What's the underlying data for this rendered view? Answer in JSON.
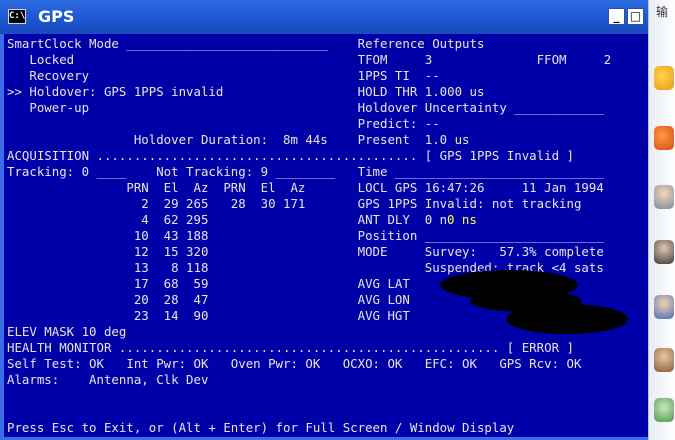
{
  "window": {
    "title": "GPS",
    "icon_label": "C:\\",
    "minimize": "_",
    "maximize": "□"
  },
  "taskbar_text": "输",
  "lines": [
    "SmartClock Mode ___________________________    Reference Outputs",
    "   Locked                                      TFOM     3              FFOM     2",
    "   Recovery                                    1PPS TI  --",
    ">> Holdover: GPS 1PPS invalid                  HOLD THR 1.000 us",
    "   Power-up                                    Holdover Uncertainty ____________",
    "                                               Predict: --",
    "                 Holdover Duration:  8m 44s    Present  1.0 us",
    "ACQUISITION ........................................... [ GPS 1PPS Invalid ]",
    "Tracking: 0 ____    Not Tracking: 9 ________   Time ____________________________",
    "                PRN  El  Az  PRN  El  Az       LOCL GPS 16:47:26     11 Jan 1994",
    "                  2  29 265   28  30 171       GPS 1PPS Invalid: not tracking",
    "                  4  62 295                    ANT DLY  0 ns",
    "                 10  43 188                    Position ________________________",
    "                 12  15 320                    MODE     Survey:   57.3% complete",
    "                 13   8 118                             Suspended: track <4 sats",
    "                 17  68  59                    AVG LAT",
    "                 20  28  47                    AVG LON",
    "                 23  14  90                    AVG HGT                         L>",
    "ELEV MASK 10 deg",
    "HEALTH MONITOR ................................................... [ ERROR ]",
    "Self Test: OK   Int Pwr: OK   Oven Pwr: OK   OCXO: OK   EFC: OK   GPS Rcv: OK",
    "Alarms:    Antenna, Clk Dev",
    "",
    "",
    "Press Esc to Exit, or (Alt + Enter) for Full Screen / Window Display"
  ],
  "highlight": {
    "ant_dly_value": "0 ns"
  }
}
